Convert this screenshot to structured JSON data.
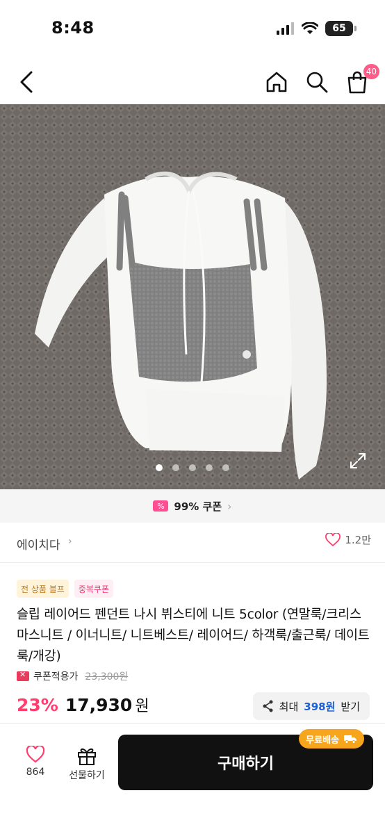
{
  "status_bar": {
    "time": "8:48",
    "battery": "65"
  },
  "nav": {
    "cart_count": "40"
  },
  "gallery": {
    "image_count": 5,
    "active_index": 0
  },
  "coupon_strip": {
    "text": "99% 쿠폰"
  },
  "shop": {
    "name": "에이치다",
    "likes": "1.2만"
  },
  "badges": {
    "sale": "전 상품 블프",
    "dup_coupon": "중복쿠폰"
  },
  "product": {
    "title": "슬립 레이어드 펜던트 나시 뷔스티에 니트 5color (연말룩/크리스마스니트 / 이너니트/ 니트베스트/ 레이어드/ 하객룩/출근룩/ 데이트룩/개강)",
    "coupon_applied_label": "쿠폰적용가",
    "original_price": "23,300원",
    "discount_rate": "23%",
    "price": "17,930",
    "price_unit": "원"
  },
  "max_coupon": {
    "prefix": "최대",
    "amount": "398원",
    "suffix": "받기"
  },
  "bottom_bar": {
    "like_count": "864",
    "gift_label": "선물하기",
    "buy_label": "구매하기",
    "free_shipping": "무료배송"
  },
  "colors": {
    "accent_pink": "#ff3d6e",
    "coupon_blue": "#1e61d6",
    "ship_orange": "#f7a51d"
  }
}
